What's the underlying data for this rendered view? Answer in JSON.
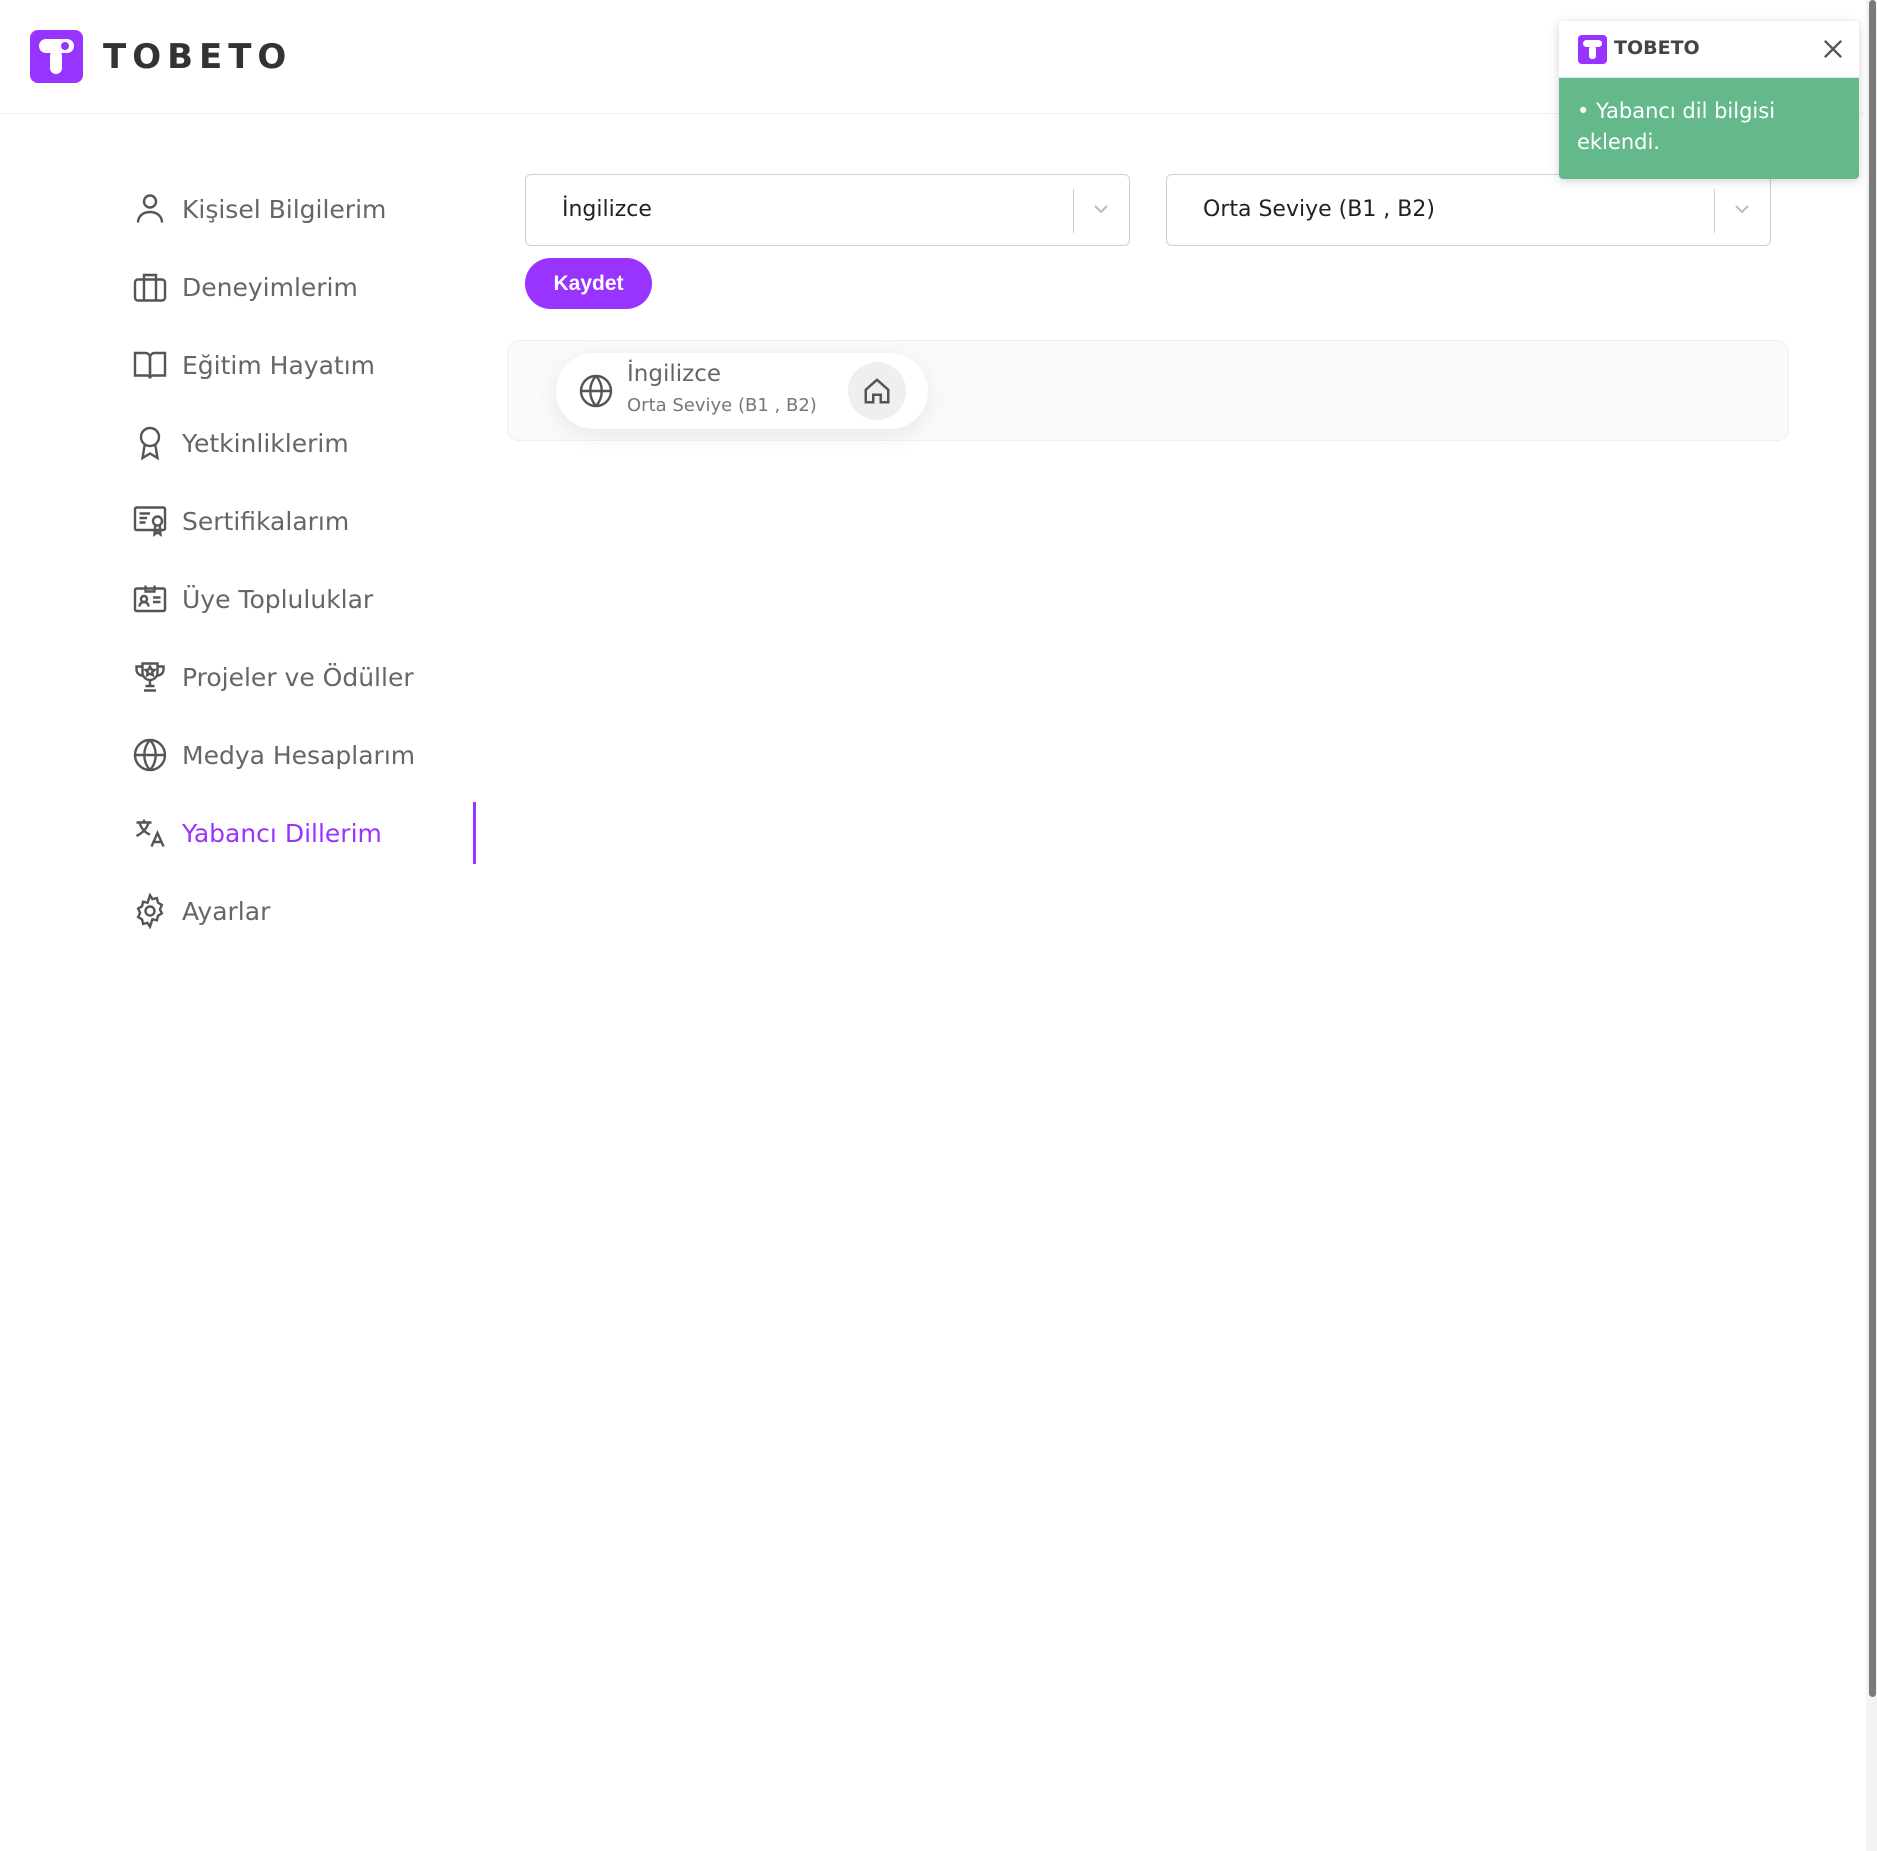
{
  "brand": {
    "name": "TOBETO",
    "accent": "#9933ff"
  },
  "sidebar": {
    "items": [
      {
        "label": "Kişisel Bilgilerim",
        "icon": "user-icon"
      },
      {
        "label": "Deneyimlerim",
        "icon": "briefcase-icon"
      },
      {
        "label": "Eğitim Hayatım",
        "icon": "book-icon"
      },
      {
        "label": "Yetkinliklerim",
        "icon": "award-icon"
      },
      {
        "label": "Sertifikalarım",
        "icon": "certificate-icon"
      },
      {
        "label": "Üye Topluluklar",
        "icon": "id-card-icon"
      },
      {
        "label": "Projeler ve Ödüller",
        "icon": "trophy-icon"
      },
      {
        "label": "Medya Hesaplarım",
        "icon": "globe-icon"
      },
      {
        "label": "Yabancı Dillerim",
        "icon": "translate-icon",
        "active": true
      },
      {
        "label": "Ayarlar",
        "icon": "gear-icon"
      }
    ]
  },
  "form": {
    "language_value": "İngilizce",
    "level_value": "Orta Seviye (B1 , B2)",
    "save_label": "Kaydet"
  },
  "languages": [
    {
      "name": "İngilizce",
      "level": "Orta Seviye (B1 , B2)"
    }
  ],
  "toast": {
    "title": "TOBETO",
    "message": "• Yabancı dil bilgisi eklendi.",
    "color": "#64b98b"
  }
}
